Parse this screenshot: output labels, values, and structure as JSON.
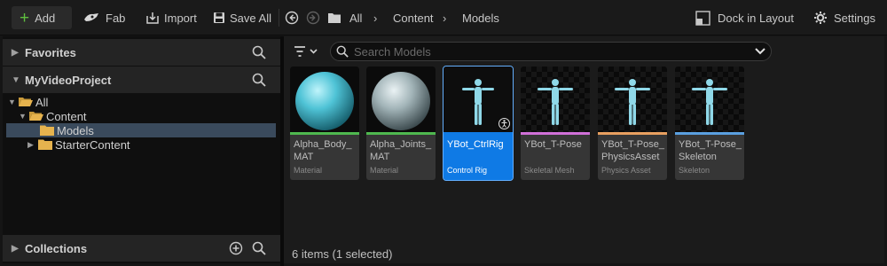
{
  "toolbar": {
    "add_label": "Add",
    "fab_label": "Fab",
    "import_label": "Import",
    "save_all_label": "Save All",
    "dock_label": "Dock in Layout",
    "settings_label": "Settings"
  },
  "breadcrumb": [
    "All",
    "Content",
    "Models"
  ],
  "sidebar": {
    "favorites_label": "Favorites",
    "project_label": "MyVideoProject",
    "collections_label": "Collections",
    "tree": [
      {
        "label": "All"
      },
      {
        "label": "Content"
      },
      {
        "label": "Models",
        "selected": true
      },
      {
        "label": "StarterContent"
      }
    ]
  },
  "content": {
    "search_placeholder": "Search Models",
    "status": "6 items (1 selected)",
    "assets": [
      {
        "name": "Alpha_Body_ MAT",
        "type": "Material",
        "color": "#4fb84f",
        "thumb": "sphere-cyan-icon",
        "selected": false
      },
      {
        "name": "Alpha_Joints_ MAT",
        "type": "Material",
        "color": "#4fb84f",
        "thumb": "sphere-gray-icon",
        "selected": false
      },
      {
        "name": "YBot_CtrlRig",
        "type": "Control Rig",
        "color": "#0f7ae5",
        "thumb": "mannequin-icon",
        "selected": true
      },
      {
        "name": "YBot_T-Pose",
        "type": "Skeletal Mesh",
        "color": "#d070d8",
        "thumb": "mannequin-icon",
        "selected": false
      },
      {
        "name": "YBot_T-Pose_ PhysicsAsset",
        "type": "Physics Asset",
        "color": "#e8a060",
        "thumb": "mannequin-icon",
        "selected": false
      },
      {
        "name": "YBot_T-Pose_ Skeleton",
        "type": "Skeleton",
        "color": "#5aa0e0",
        "thumb": "mannequin-icon",
        "selected": false
      }
    ]
  },
  "colors": {
    "accent": "#0f7ae5",
    "add_plus": "#5fbf3f",
    "folder": "#e6b34e"
  }
}
